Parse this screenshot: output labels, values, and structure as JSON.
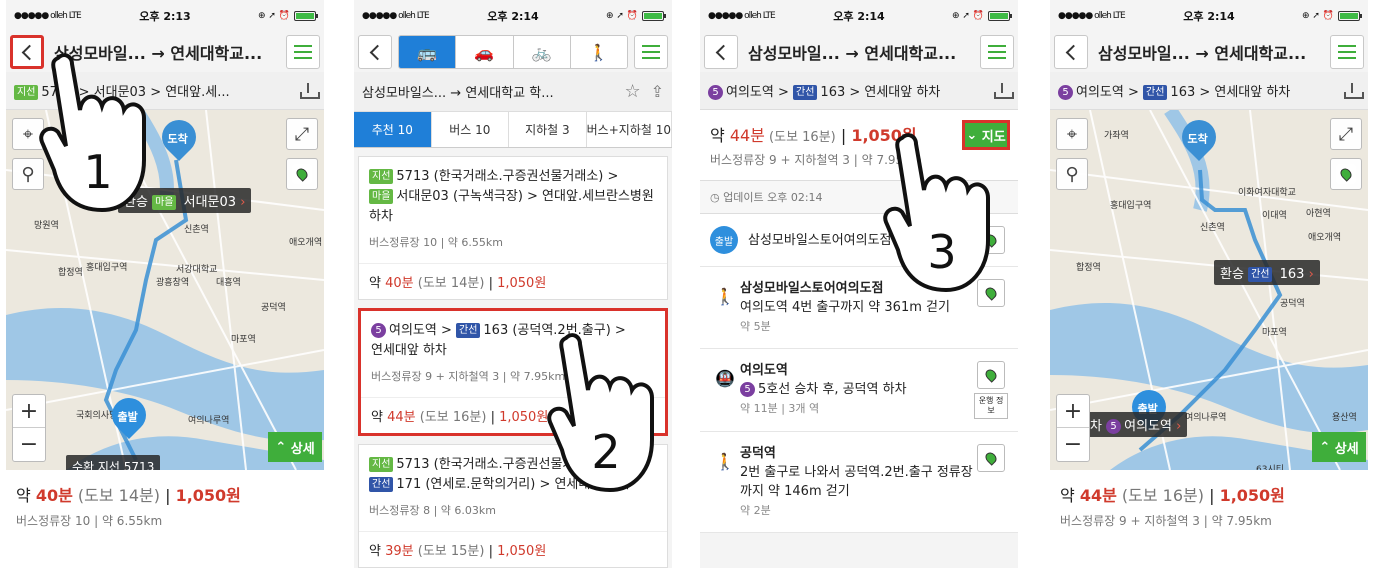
{
  "status": {
    "carrier": "olleh",
    "network": "LTE",
    "times": [
      "오후 2:13",
      "오후 2:14",
      "오후 2:14",
      "오후 2:14"
    ]
  },
  "header": {
    "title": "삼성모바일... → 연세대학교...",
    "title_p2": "삼성모바일스... → 연세대학교 학...",
    "menu_icon": "hamburger-icon",
    "back_icon": "chevron-left-icon"
  },
  "panel1": {
    "route_strip": "5713 > 서대문03 > 연대앞.세...",
    "route_badges": [
      "지선"
    ],
    "transfer_label": "환승",
    "transfer_badge": "마을",
    "transfer_stop": "서대문03",
    "arrival_label": "도착",
    "departure_label": "출발",
    "bottom_label": "수환 지선 5713",
    "detail_button": "상세",
    "summary_prefix": "약 ",
    "summary_minutes": "40분",
    "summary_walk": " (도보 14분)",
    "summary_fare": "1,050원",
    "summary_sub": "버스정류장 10  |  약 6.55km",
    "step_number": "1",
    "map_labels": [
      "가좌역",
      "망원역",
      "서대문역",
      "신촌역",
      "홍대입구역",
      "합정역",
      "서강대학교",
      "공덕역",
      "여의나루역",
      "국회의사당",
      "애오개역",
      "마포역",
      "대흥역",
      "광흥창역"
    ]
  },
  "panel2": {
    "modes": [
      "bus",
      "car",
      "bike",
      "walk"
    ],
    "tabs": [
      "추천 10",
      "버스 10",
      "지하철 3",
      "버스+지하철 10"
    ],
    "cards": [
      {
        "line1": "5713 (한국거래소.구증권선물거래소) >",
        "badge1": "지선",
        "line2": "서대문03 (구녹색극장) > 연대앞.세브란스병원 하차",
        "badge2": "마을",
        "meta": "버스정류장 10  |  약 6.55km",
        "minutes": "40분",
        "walk": " (도보 14분)",
        "fare": "1,050원"
      },
      {
        "line1": "여의도역 > ",
        "badge_circle": "5",
        "badge1": "간선",
        "bus": "163 (공덕역.2번.출구) >",
        "line2": "연세대앞 하차",
        "meta": "버스정류장 9 + 지하철역 3  |  약 7.95km",
        "minutes": "44분",
        "walk": " (도보 16분)",
        "fare": "1,050원"
      },
      {
        "line1": "5713 (한국거래소.구증권선물거래소) >",
        "badge1": "지선",
        "line2": "171 (연세로.문학의거리) > 연세대앞 하차",
        "badge2": "간선",
        "meta": "버스정류장 8  |  약 6.03km",
        "minutes": "39분",
        "walk": " (도보 15분)",
        "fare": "1,050원"
      }
    ],
    "step_number": "2"
  },
  "panel3": {
    "route_strip_station": "여의도역 >",
    "route_strip_badge": "간선",
    "route_strip_rest": "163 > 연세대앞 하차",
    "summary_minutes": "44분",
    "summary_walk": " (도보 16분)",
    "summary_fare": "1,050원",
    "summary_sub": "버스정류장 9 + 지하철역 3  |  약 7.95km",
    "map_button": "지도",
    "update_text": "업데이트 오후 02:14",
    "start_badge": "출발",
    "start_place": "삼성모바일스토어여의도점",
    "steps": [
      {
        "title": "삼성모바일스토어여의도점",
        "desc": "여의도역 4번 출구까지 약 361m 걷기",
        "time": "약 5분"
      },
      {
        "title": "여의도역",
        "desc": "5호선 승차 후, 공덕역 하차",
        "time": "약 11분  |  3개 역",
        "extra_button": "운행 정보"
      },
      {
        "title": "공덕역",
        "desc": "2번 출구로 나와서 공덕역.2번.출구 정류장까지 약 146m 걷기",
        "time": "약 2분"
      }
    ],
    "step_number": "3"
  },
  "panel4": {
    "route_strip_station": "여의도역 >",
    "route_strip_badge": "간선",
    "route_strip_rest": "163 > 연세대앞 하차",
    "transfer_label": "환승",
    "transfer_badge": "간선",
    "transfer_bus": "163",
    "bottom_station": "여의도역",
    "bottom_prefix": "차",
    "arrival_label": "도착",
    "departure_label": "출발",
    "detail_button": "상세",
    "summary_minutes": "44분",
    "summary_walk": " (도보 16분)",
    "summary_fare": "1,050원",
    "summary_sub": "버스정류장 9 + 지하철역 3  |  약 7.95km",
    "map_labels": [
      "가좌역",
      "신촌역",
      "이대역",
      "아현역",
      "이화여자대학교",
      "홍대입구역",
      "애오개역",
      "합정역",
      "공덕역",
      "마포역",
      "여의나루역",
      "용산역",
      "63시티"
    ]
  },
  "colors": {
    "accent_green": "#3fae3b",
    "accent_blue": "#1f7fd8",
    "highlight_red": "#d9322b",
    "fare_red": "#d03a2c",
    "line5_purple": "#7b3fa0",
    "trunk_bus_blue": "#3055a8"
  }
}
